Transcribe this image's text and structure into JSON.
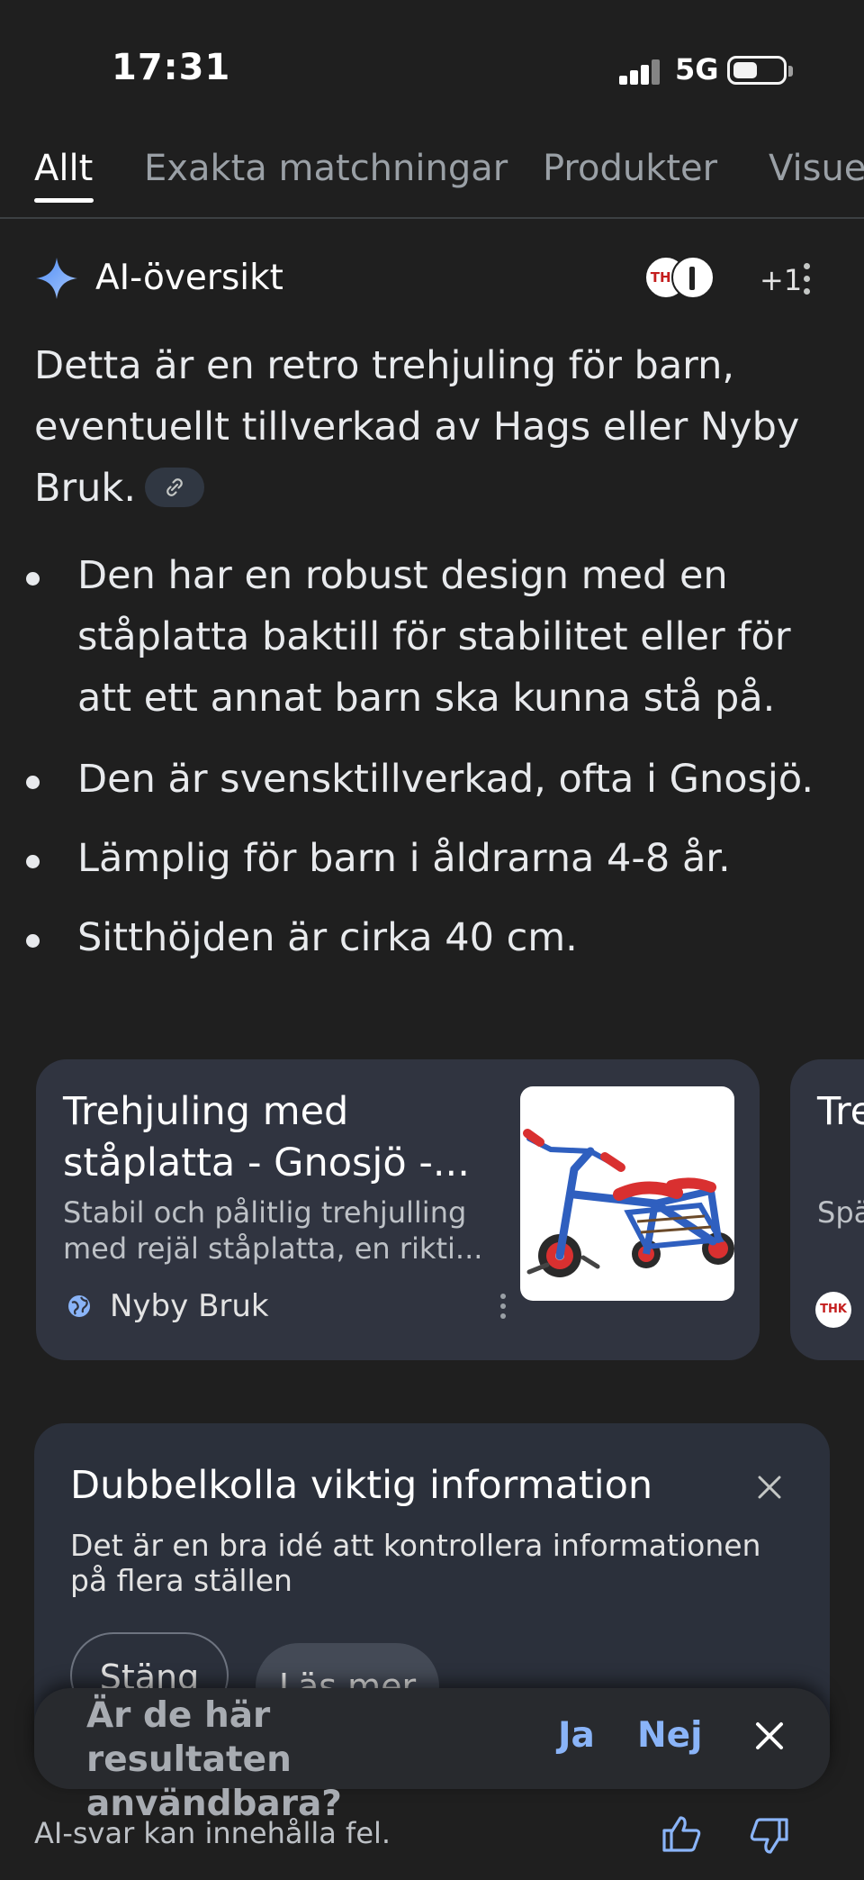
{
  "status_bar": {
    "time": "17:31",
    "network": "5G"
  },
  "tabs": [
    {
      "label": "Allt",
      "active": true
    },
    {
      "label": "Exakta matchningar",
      "active": false
    },
    {
      "label": "Produkter",
      "active": false
    },
    {
      "label": "Visuel",
      "active": false
    }
  ],
  "ai_overview": {
    "title": "AI-översikt",
    "source_avatars": [
      "THK",
      ""
    ],
    "extra_sources": "+1",
    "summary": "Detta är en retro trehjuling för barn, eventuellt tillverkad av Hags eller Nyby Bruk.",
    "bullets": [
      "Den har en robust design med en ståplatta baktill för stabilitet eller för att ett annat barn ska kunna stå på.",
      "Den är svensktillverkad, ofta i Gnosjö.",
      "Lämplig för barn i åldrarna 4-8 år.",
      "Sitthöjden är cirka 40 cm."
    ]
  },
  "cards": [
    {
      "title": "Trehjuling med ståplatta - Gnosjö -...",
      "description": "Stabil och pålitlig trehjulling med rejäl ståplatta, en rikti...",
      "source": "Nyby Bruk"
    },
    {
      "title": "Tre stå",
      "description": "Spä hop",
      "source": "THK"
    }
  ],
  "info_card": {
    "title": "Dubbelkolla viktig information",
    "text": "Det är en bra idé att kontrollera informationen på flera ställen",
    "close_button": "Stäng",
    "more_button": "Läs mer"
  },
  "feedback": {
    "question": "Är de här resultaten användbara?",
    "yes": "Ja",
    "no": "Nej"
  },
  "footer": {
    "disclaimer": "AI-svar kan innehålla fel."
  },
  "colors": {
    "background": "#1f1f1f",
    "accent": "#8ab4f8",
    "card": "#303440"
  }
}
